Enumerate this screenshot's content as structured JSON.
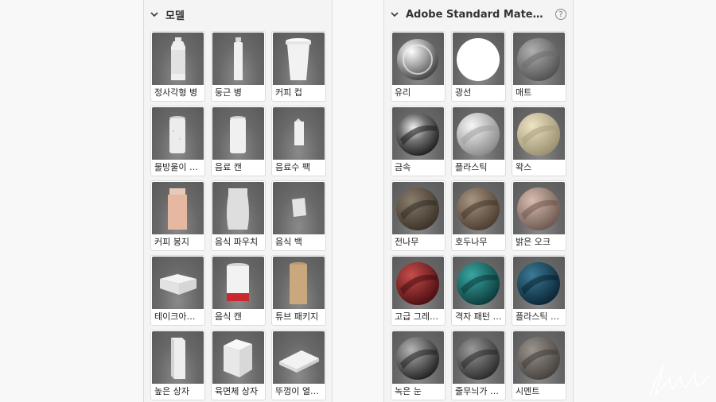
{
  "models_panel": {
    "title": "모델",
    "items": [
      {
        "label": "정사각형 병",
        "icon": "square-bottle-icon"
      },
      {
        "label": "둥근 병",
        "icon": "round-bottle-icon"
      },
      {
        "label": "커피 컵",
        "icon": "coffee-cup-icon"
      },
      {
        "label": "물방울이 맺힌 캔",
        "icon": "condensation-can-icon"
      },
      {
        "label": "음료 캔",
        "icon": "beverage-can-icon"
      },
      {
        "label": "음료수 팩",
        "icon": "drink-carton-icon"
      },
      {
        "label": "커피 봉지",
        "icon": "coffee-bag-icon"
      },
      {
        "label": "음식 파우치",
        "icon": "food-pouch-icon"
      },
      {
        "label": "음식 백",
        "icon": "food-bag-icon"
      },
      {
        "label": "테이크아웃 용기",
        "icon": "takeout-container-icon"
      },
      {
        "label": "음식 캔",
        "icon": "food-can-icon"
      },
      {
        "label": "튜브 패키지",
        "icon": "tube-package-icon"
      },
      {
        "label": "높은 상자",
        "icon": "tall-box-icon"
      },
      {
        "label": "육면체 상자",
        "icon": "cube-box-icon"
      },
      {
        "label": "뚜껑이 열린 상자",
        "icon": "open-lid-box-icon"
      }
    ]
  },
  "materials_panel": {
    "title": "Adobe Standard Materials",
    "help_symbol": "?",
    "items": [
      {
        "label": "유리",
        "icon": "glass-sphere-icon"
      },
      {
        "label": "광선",
        "icon": "light-sphere-icon"
      },
      {
        "label": "매트",
        "icon": "matte-sphere-icon"
      },
      {
        "label": "금속",
        "icon": "metal-sphere-icon"
      },
      {
        "label": "플라스틱",
        "icon": "plastic-sphere-icon"
      },
      {
        "label": "왁스",
        "icon": "wax-sphere-icon"
      },
      {
        "label": "전나무",
        "icon": "fir-wood-sphere-icon"
      },
      {
        "label": "호두나무",
        "icon": "walnut-sphere-icon"
      },
      {
        "label": "밝은 오크",
        "icon": "light-oak-sphere-icon"
      },
      {
        "label": "고급 그레인 가죽",
        "icon": "grain-leather-sphere-icon"
      },
      {
        "label": "격자 패턴 직물",
        "icon": "grid-fabric-sphere-icon"
      },
      {
        "label": "플라스틱 코팅",
        "icon": "coated-plastic-sphere-icon"
      },
      {
        "label": "녹은 눈",
        "icon": "melted-snow-sphere-icon"
      },
      {
        "label": "줄무늬가 있는 대리석",
        "icon": "striped-marble-sphere-icon"
      },
      {
        "label": "시멘트",
        "icon": "cement-sphere-icon"
      }
    ]
  },
  "colors": {
    "panel_bg": "#f4f4f4",
    "thumb_bg": "#6a6a6a",
    "text": "#222222",
    "header_text": "#333333"
  }
}
